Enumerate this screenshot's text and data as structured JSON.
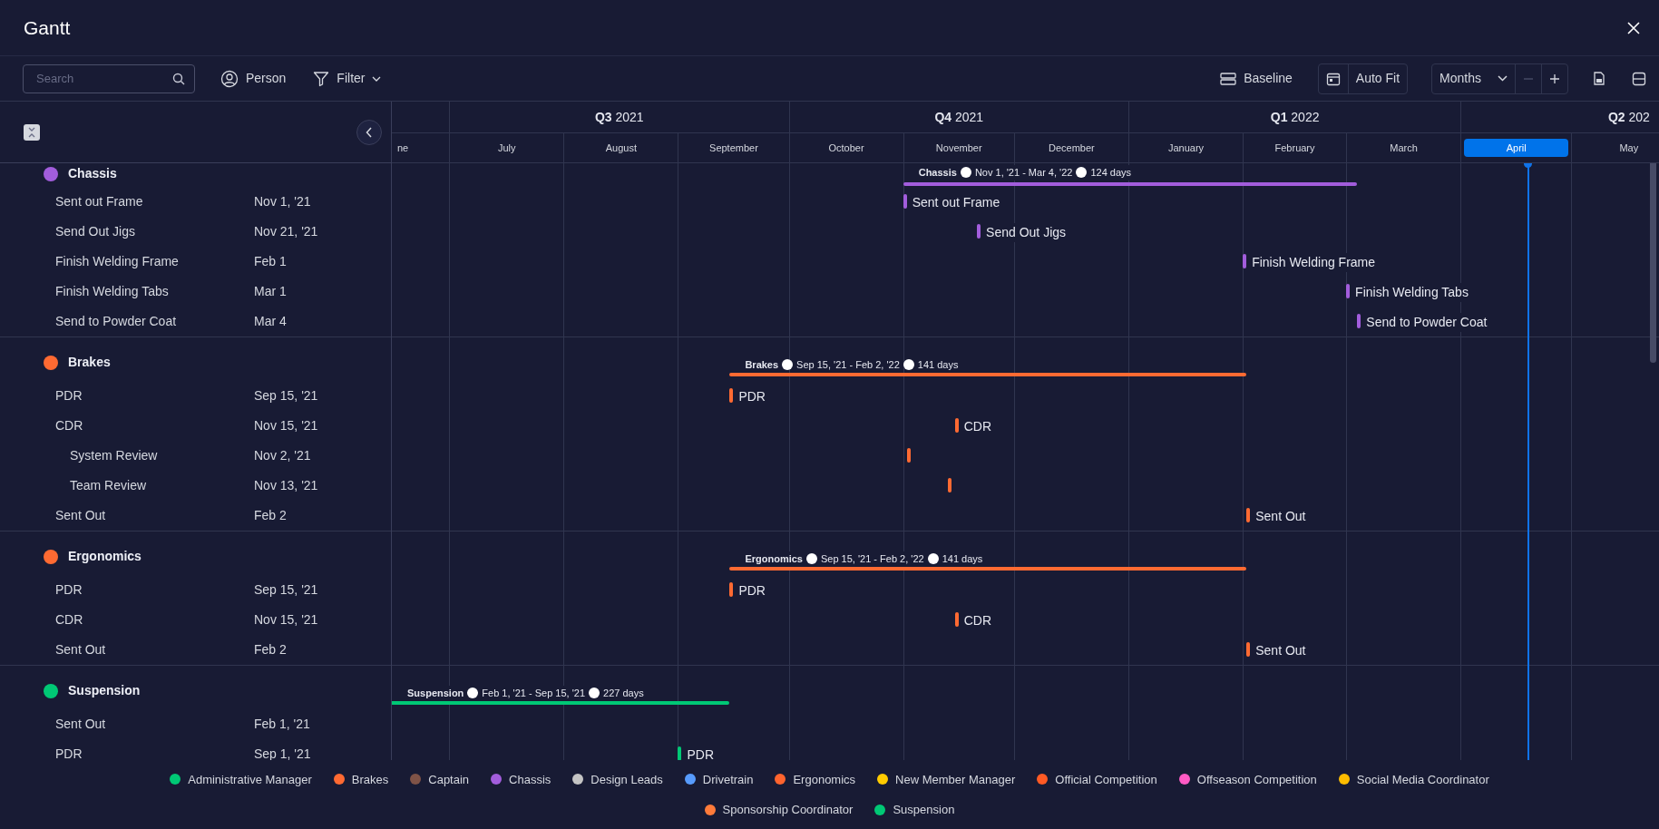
{
  "window": {
    "title": "Gantt"
  },
  "toolbar": {
    "search": {
      "placeholder": "Search"
    },
    "person": "Person",
    "filter": "Filter",
    "baseline": "Baseline",
    "auto_fit": "Auto Fit",
    "scale": {
      "value": "Months"
    },
    "zoom_out": {
      "disabled": true
    },
    "zoom_in": {
      "disabled": false
    }
  },
  "timeline": {
    "quarters": [
      {
        "label": "**Q3** 2021"
      },
      {
        "label": "**Q4** 2021"
      },
      {
        "label": "**Q1** 2022"
      },
      {
        "label": "**Q2** 202"
      }
    ],
    "months": [
      {
        "label": "ne",
        "selected": false
      },
      {
        "label": "July",
        "selected": false
      },
      {
        "label": "August",
        "selected": false
      },
      {
        "label": "September",
        "selected": false
      },
      {
        "label": "October",
        "selected": false
      },
      {
        "label": "November",
        "selected": false
      },
      {
        "label": "December",
        "selected": false
      },
      {
        "label": "January",
        "selected": false
      },
      {
        "label": "February",
        "selected": false
      },
      {
        "label": "March",
        "selected": false
      },
      {
        "label": "April",
        "selected": true
      },
      {
        "label": "May",
        "selected": false
      }
    ]
  },
  "groups": [
    {
      "name": "Chassis",
      "color": "#a25ddc",
      "summary": {
        "title": "Chassis",
        "range": "Nov 1, '21 - Mar 4, '22",
        "duration": "124 days"
      },
      "tasks": [
        {
          "name": "Sent out Frame",
          "date": "Nov 1, '21",
          "timeline_label": "Sent out Frame"
        },
        {
          "name": "Send Out Jigs",
          "date": "Nov 21, '21",
          "timeline_label": "Send Out Jigs"
        },
        {
          "name": "Finish Welding Frame",
          "date": "Feb 1",
          "timeline_label": "Finish Welding Frame"
        },
        {
          "name": "Finish Welding Tabs",
          "date": "Mar 1",
          "timeline_label": "Finish Welding Tabs"
        },
        {
          "name": "Send to Powder Coat",
          "date": "Mar 4",
          "timeline_label": "Send to Powder Coat"
        }
      ]
    },
    {
      "name": "Brakes",
      "color": "#ff6a32",
      "summary": {
        "title": "Brakes",
        "range": "Sep 15, '21 - Feb 2, '22",
        "duration": "141 days"
      },
      "tasks": [
        {
          "name": "PDR",
          "date": "Sep 15, '21",
          "timeline_label": "PDR"
        },
        {
          "name": "CDR",
          "date": "Nov 15, '21",
          "timeline_label": "CDR",
          "children": [
            {
              "name": "System Review",
              "date": "Nov 2, '21"
            },
            {
              "name": "Team Review",
              "date": "Nov 13, '21"
            }
          ]
        },
        {
          "name": "Sent Out",
          "date": "Feb 2",
          "timeline_label": "Sent Out"
        }
      ]
    },
    {
      "name": "Ergonomics",
      "color": "#ff6a32",
      "summary": {
        "title": "Ergonomics",
        "range": "Sep 15, '21 - Feb 2, '22",
        "duration": "141 days"
      },
      "tasks": [
        {
          "name": "PDR",
          "date": "Sep 15, '21",
          "timeline_label": "PDR"
        },
        {
          "name": "CDR",
          "date": "Nov 15, '21",
          "timeline_label": "CDR"
        },
        {
          "name": "Sent Out",
          "date": "Feb 2",
          "timeline_label": "Sent Out"
        }
      ]
    },
    {
      "name": "Suspension",
      "color": "#00c875",
      "summary": {
        "title": "Suspension",
        "range": "Feb 1, '21 - Sep 15, '21",
        "duration": "227 days"
      },
      "tasks": [
        {
          "name": "Sent Out",
          "date": "Feb 1, '21"
        },
        {
          "name": "PDR",
          "date": "Sep 1, '21",
          "timeline_label": "PDR"
        }
      ]
    }
  ],
  "legend": [
    {
      "label": "Administrative Manager",
      "color": "#00c875"
    },
    {
      "label": "Brakes",
      "color": "#ff6a32"
    },
    {
      "label": "Captain",
      "color": "#7f5347"
    },
    {
      "label": "Chassis",
      "color": "#a25ddc"
    },
    {
      "label": "Design Leads",
      "color": "#c4c4c4"
    },
    {
      "label": "Drivetrain",
      "color": "#579bfc"
    },
    {
      "label": "Ergonomics",
      "color": "#ff642e"
    },
    {
      "label": "New Member Manager",
      "color": "#ffcb00"
    },
    {
      "label": "Official Competition",
      "color": "#ff5a24"
    },
    {
      "label": "Offseason Competition",
      "color": "#ff5ac4"
    },
    {
      "label": "Social Media Coordinator",
      "color": "#fdbc00"
    },
    {
      "label": "Sponsorship Coordinator",
      "color": "#ff7b3a"
    },
    {
      "label": "Suspension",
      "color": "#00c875"
    }
  ]
}
